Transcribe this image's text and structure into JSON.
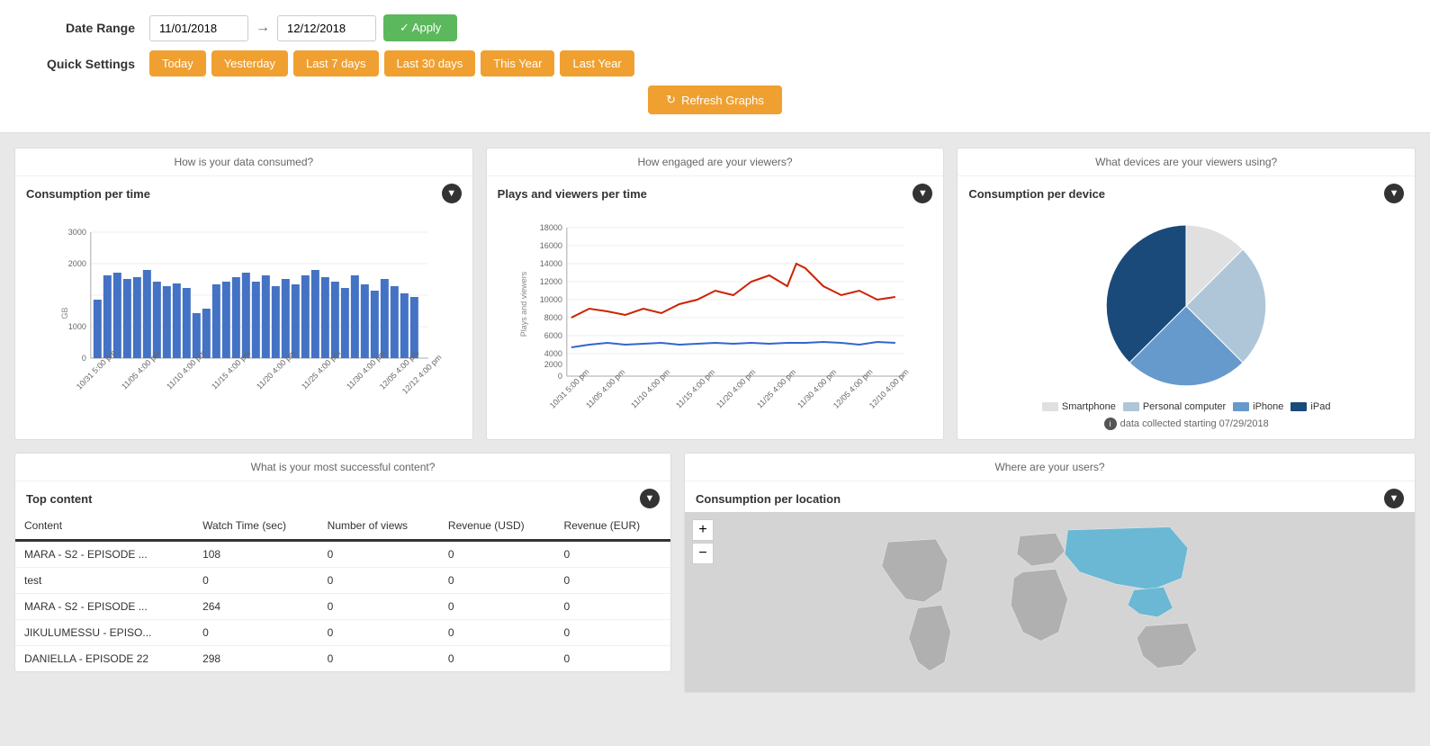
{
  "filter": {
    "label_date_range": "Date Range",
    "label_quick_settings": "Quick Settings",
    "date_from": "11/01/2018",
    "date_to": "12/12/2018",
    "apply_label": "✓ Apply",
    "quick_buttons": [
      "Today",
      "Yesterday",
      "Last 7 days",
      "Last 30 days",
      "This Year",
      "Last Year"
    ],
    "refresh_label": "Refresh Graphs"
  },
  "consumption_chart": {
    "header": "How is your data consumed?",
    "title": "Consumption per time",
    "y_label": "GB",
    "x_labels": [
      "10/31 5:00 pm",
      "11/05 4:00 pm",
      "11/10 4:00 pm",
      "11/15 4:00 pm",
      "11/20 4:00 pm",
      "11/25 4:00 pm",
      "11/30 4:00 pm",
      "12/05 4:00 pm",
      "12/12 4:00 pm"
    ]
  },
  "plays_chart": {
    "header": "How engaged are your viewers?",
    "title": "Plays and viewers per time",
    "y_label": "Plays and viewers",
    "x_labels": [
      "10/31 5:00 pm",
      "11/05 4:00 pm",
      "11/10 4:00 pm",
      "11/15 4:00 pm",
      "11/20 4:00 pm",
      "11/25 4:00 pm",
      "11/30 4:00 pm",
      "12/05 4:00 pm",
      "12/10 4:00 pm"
    ]
  },
  "device_chart": {
    "header": "What devices are your viewers using?",
    "title": "Consumption per device",
    "legend": [
      {
        "label": "Smartphone",
        "color": "#e8e8e8"
      },
      {
        "label": "Personal computer",
        "color": "#b0c4de"
      },
      {
        "label": "iPhone",
        "color": "#6699cc"
      },
      {
        "label": "iPad",
        "color": "#1a4a7a"
      }
    ],
    "data_note": "data collected starting 07/29/2018",
    "slices": [
      {
        "label": "Smartphone",
        "value": 15,
        "color": "#e8e8e8"
      },
      {
        "label": "Personal computer",
        "value": 30,
        "color": "#b0c4de"
      },
      {
        "label": "iPhone",
        "value": 25,
        "color": "#6699cc"
      },
      {
        "label": "iPad",
        "value": 30,
        "color": "#1a4a7a"
      }
    ]
  },
  "top_content": {
    "section_header": "What is your most successful content?",
    "title": "Top content",
    "columns": [
      "Content",
      "Watch Time (sec)",
      "Number of views",
      "Revenue (USD)",
      "Revenue (EUR)"
    ],
    "rows": [
      {
        "content": "MARA - S2 - EPISODE ...",
        "watch_time": "108",
        "views": "0",
        "revenue_usd": "0",
        "revenue_eur": "0"
      },
      {
        "content": "test",
        "watch_time": "0",
        "views": "0",
        "revenue_usd": "0",
        "revenue_eur": "0"
      },
      {
        "content": "MARA - S2 - EPISODE ...",
        "watch_time": "264",
        "views": "0",
        "revenue_usd": "0",
        "revenue_eur": "0"
      },
      {
        "content": "JIKULUMESSU - EPISO...",
        "watch_time": "0",
        "views": "0",
        "revenue_usd": "0",
        "revenue_eur": "0"
      },
      {
        "content": "DANIELLA - EPISODE 22",
        "watch_time": "298",
        "views": "0",
        "revenue_usd": "0",
        "revenue_eur": "0"
      }
    ]
  },
  "location_chart": {
    "section_header": "Where are your users?",
    "title": "Consumption per location"
  }
}
